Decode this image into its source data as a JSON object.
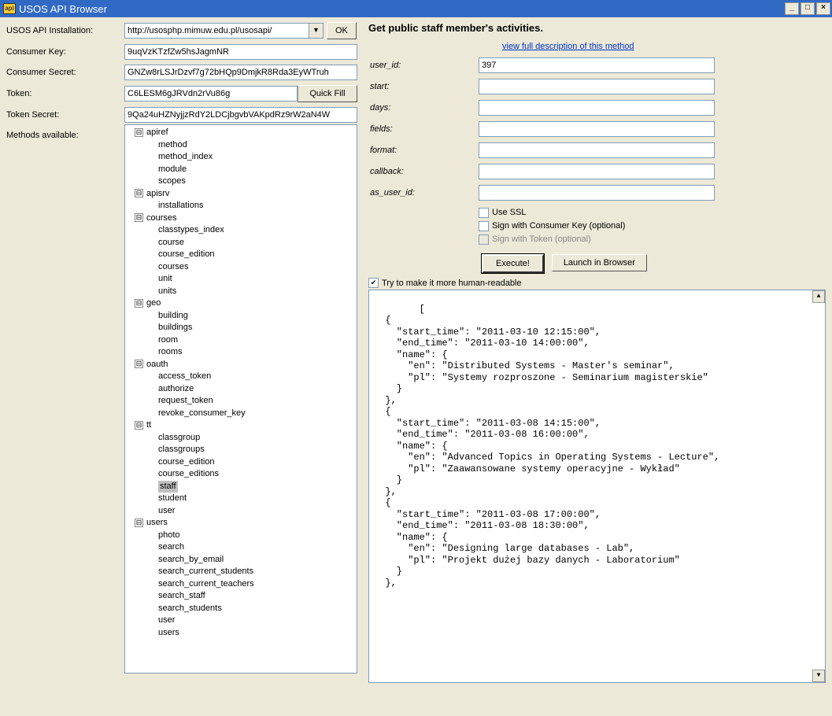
{
  "window": {
    "title": "USOS API Browser",
    "min": "_",
    "max": "□",
    "close": "×"
  },
  "left": {
    "install_label": "USOS API Installation:",
    "install_value": "http://usosphp.mimuw.edu.pl/usosapi/",
    "ok_label": "OK",
    "ckey_label": "Consumer Key:",
    "ckey_value": "9uqVzKTzfZw5hsJagmNR",
    "csecret_label": "Consumer Secret:",
    "csecret_value": "GNZw8rLSJrDzvf7g72bHQp9DmjkR8Rda3EyWTruh",
    "token_label": "Token:",
    "token_value": "C6LESM6gJRVdn2rVu86g",
    "quickfill_label": "Quick Fill",
    "tsecret_label": "Token Secret:",
    "tsecret_value": "9Qa24uHZNyjjzRdY2LDCjbgvbVAKpdRz9rW2aN4W",
    "methods_label": "Methods available:"
  },
  "tree": {
    "exp": "⊟",
    "cats": [
      {
        "name": "apiref",
        "items": [
          "method",
          "method_index",
          "module",
          "scopes"
        ]
      },
      {
        "name": "apisrv",
        "items": [
          "installations"
        ]
      },
      {
        "name": "courses",
        "items": [
          "classtypes_index",
          "course",
          "course_edition",
          "courses",
          "unit",
          "units"
        ]
      },
      {
        "name": "geo",
        "items": [
          "building",
          "buildings",
          "room",
          "rooms"
        ]
      },
      {
        "name": "oauth",
        "items": [
          "access_token",
          "authorize",
          "request_token",
          "revoke_consumer_key"
        ]
      },
      {
        "name": "tt",
        "items": [
          "classgroup",
          "classgroups",
          "course_edition",
          "course_editions",
          "staff",
          "student",
          "user"
        ],
        "selected": "staff"
      },
      {
        "name": "users",
        "items": [
          "photo",
          "search",
          "search_by_email",
          "search_current_students",
          "search_current_teachers",
          "search_staff",
          "search_students",
          "user",
          "users"
        ]
      }
    ]
  },
  "right": {
    "title": "Get public staff member's activities.",
    "desc_link": "view full description of this method",
    "params": [
      {
        "name": "user_id:",
        "value": "397"
      },
      {
        "name": "start:",
        "value": ""
      },
      {
        "name": "days:",
        "value": ""
      },
      {
        "name": "fields:",
        "value": ""
      },
      {
        "name": "format:",
        "value": ""
      },
      {
        "name": "callback:",
        "value": ""
      },
      {
        "name": "as_user_id:",
        "value": ""
      }
    ],
    "use_ssl": "Use SSL",
    "sign_ckey": "Sign with Consumer Key (optional)",
    "sign_token": "Sign with Token (optional)",
    "execute": "Execute!",
    "launch": "Launch in Browser",
    "human_readable": "Try to make it more human-readable",
    "output": "[\n  {\n    \"start_time\": \"2011-03-10 12:15:00\",\n    \"end_time\": \"2011-03-10 14:00:00\",\n    \"name\": {\n      \"en\": \"Distributed Systems - Master's seminar\",\n      \"pl\": \"Systemy rozproszone - Seminarium magisterskie\"\n    }\n  },\n  {\n    \"start_time\": \"2011-03-08 14:15:00\",\n    \"end_time\": \"2011-03-08 16:00:00\",\n    \"name\": {\n      \"en\": \"Advanced Topics in Operating Systems - Lecture\",\n      \"pl\": \"Zaawansowane systemy operacyjne - Wykład\"\n    }\n  },\n  {\n    \"start_time\": \"2011-03-08 17:00:00\",\n    \"end_time\": \"2011-03-08 18:30:00\",\n    \"name\": {\n      \"en\": \"Designing large databases - Lab\",\n      \"pl\": \"Projekt dużej bazy danych - Laboratorium\"\n    }\n  },"
  }
}
